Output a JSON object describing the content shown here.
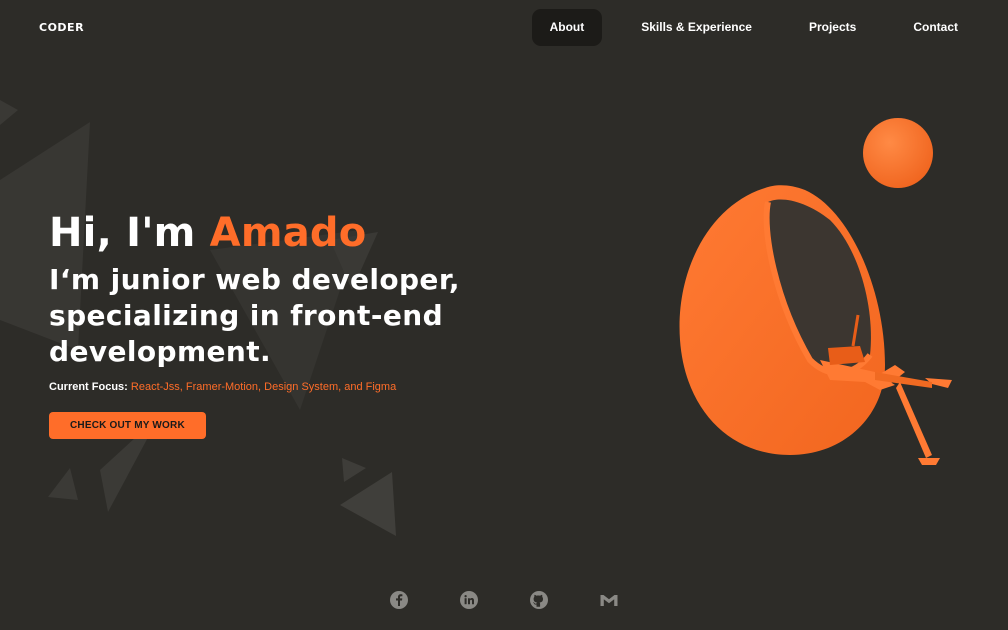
{
  "logo": {
    "text": "CODER"
  },
  "nav": {
    "items": [
      {
        "label": "About",
        "active": true
      },
      {
        "label": "Skills & Experience",
        "active": false
      },
      {
        "label": "Projects",
        "active": false
      },
      {
        "label": "Contact",
        "active": false
      }
    ]
  },
  "hero": {
    "greeting": "Hi, I'm ",
    "name": "Amado",
    "subtitle": "I‘m junior web developer, specializing in front-end development.",
    "focus_label": "Current Focus:",
    "focus_text": "React-Jss, Framer-Motion, Design System, and Figma",
    "cta_label": "CHECK OUT MY WORK"
  },
  "socials": [
    {
      "name": "facebook",
      "icon": "facebook-icon"
    },
    {
      "name": "linkedin",
      "icon": "linkedin-icon"
    },
    {
      "name": "github",
      "icon": "github-icon"
    },
    {
      "name": "gmail",
      "icon": "gmail-icon"
    }
  ],
  "colors": {
    "background": "#2d2c28",
    "accent": "#ff6d29",
    "nav_active": "#1c1b18",
    "text": "#ffffff",
    "icon": "#8a8985"
  }
}
